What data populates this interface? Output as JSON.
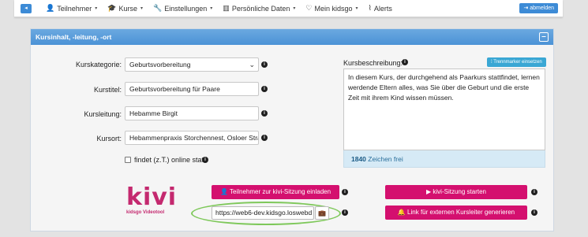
{
  "nav": {
    "items": [
      {
        "label": "Teilnehmer",
        "icon": "user-icon",
        "glyph": "👤",
        "caret": "▾"
      },
      {
        "label": "Kurse",
        "icon": "graduation-icon",
        "glyph": "🎓",
        "caret": "▾"
      },
      {
        "label": "Einstellungen",
        "icon": "wrench-icon",
        "glyph": "🔧",
        "caret": "▾"
      },
      {
        "label": "Persönliche Daten",
        "icon": "id-card-icon",
        "glyph": "▥",
        "caret": "▾"
      },
      {
        "label": "Mein kidsgo",
        "icon": "heart-icon",
        "glyph": "♡",
        "caret": "▾"
      },
      {
        "label": "Alerts",
        "icon": "rss-icon",
        "glyph": "⌇",
        "caret": ""
      }
    ],
    "logout_label": "abmelden"
  },
  "panel": {
    "title": "Kursinhalt, -leitung, -ort",
    "collapse_glyph": "–"
  },
  "form": {
    "kategorie_label": "Kurskategorie:",
    "kategorie_value": "Geburtsvorbereitung",
    "titel_label": "Kurstitel:",
    "titel_value": "Geburtsvorbereitung für Paare",
    "leitung_label": "Kursleitung:",
    "leitung_value": "Hebamme Birgit",
    "ort_label": "Kursort:",
    "ort_value": "Hebammenpraxis Storchennest, Osloer Stra",
    "online_label": "findet (z.T.) online statt"
  },
  "description": {
    "label": "Kursbeschreibung:",
    "trenn_button": "Trennmarker einsetzen",
    "text": "In diesem Kurs, der durchgehend als Paarkurs stattfindet, lernen werdende Eltern alles, was Sie über die Geburt und die erste Zeit mit ihrem Kind wissen müssen.",
    "counter_value": "1840",
    "counter_suffix": "Zeichen frei"
  },
  "kivi": {
    "logo_text": "kivi",
    "logo_subtitle": "kidsgo Videotool",
    "invite_button": "Teilnehmer zur kivi-Sitzung einladen",
    "start_button": "kivi-Sitzung starten",
    "url_value": "https://web6-dev.kidsgo.loswebd",
    "external_button": "Link für externen Kursleiter generieren"
  },
  "colors": {
    "accent": "#3d8bd6",
    "panel_header": "#4b92d6",
    "kivi_pink": "#d4106f",
    "highlight_green": "#7ec85a"
  }
}
